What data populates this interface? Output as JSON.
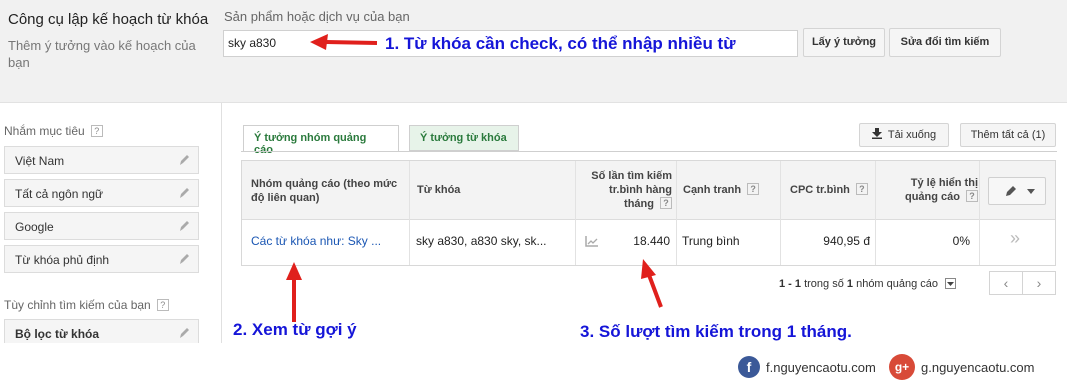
{
  "header": {
    "tool_title": "Công cụ lập kế hoạch từ khóa",
    "subtitle": "Thêm ý tưởng vào kế hoạch của bạn",
    "product_label": "Sản phẩm hoặc dịch vụ của bạn",
    "keyword_value": "sky a830",
    "get_ideas_label": "Lấy ý tưởng",
    "modify_search_label": "Sửa đổi tìm kiếm"
  },
  "sidebar": {
    "targeting_heading": "Nhắm mục tiêu",
    "help": "?",
    "items": [
      {
        "label": "Việt Nam"
      },
      {
        "label": "Tất cả ngôn ngữ"
      },
      {
        "label": "Google"
      },
      {
        "label": "Từ khóa phủ định"
      }
    ],
    "customize_heading": "Tùy chỉnh tìm kiếm của bạn",
    "filter_label": "Bộ lọc từ khóa"
  },
  "tabs": [
    {
      "label": "Ý tưởng nhóm quảng cáo",
      "active": true
    },
    {
      "label": "Ý tưởng từ khóa",
      "active": false
    }
  ],
  "toolbar": {
    "download_label": "Tải xuống",
    "add_all_label": "Thêm tất cả (1)"
  },
  "table": {
    "headers": {
      "ad_group": "Nhóm quảng cáo (theo mức độ liên quan)",
      "keywords": "Từ khóa",
      "searches_line1": "Số lần tìm kiếm",
      "searches_line2": "tr.bình hàng",
      "searches_line3": "tháng",
      "competition": "Cạnh tranh",
      "cpc": "CPC tr.bình",
      "impr_share_line1": "Tỷ lệ hiển thị",
      "impr_share_line2": "quảng cáo",
      "help": "?"
    },
    "row": {
      "ad_group": "Các từ khóa như: Sky ...",
      "keywords": "sky a830, a830 sky, sk...",
      "searches": "18.440",
      "competition": "Trung bình",
      "cpc": "940,95 đ",
      "impr_share": "0%",
      "add": "»"
    }
  },
  "pager": {
    "range": "1 - 1",
    "of_text": "trong số",
    "count": "1",
    "unit": "nhóm quảng cáo",
    "prev": "‹",
    "next": "›"
  },
  "annotations": {
    "a1": "1. Từ khóa cần check, có thể nhập nhiều từ",
    "a2": "2. Xem từ gợi ý",
    "a3": "3. Số lượt tìm kiếm trong 1 tháng.",
    "arrow_color": "#e0201c",
    "text_color": "#1515d8"
  },
  "social": {
    "facebook_text": "f.nguyencaotu.com",
    "google_text": "g.nguyencaotu.com",
    "fb_glyph": "f",
    "gp_glyph": "g+"
  }
}
